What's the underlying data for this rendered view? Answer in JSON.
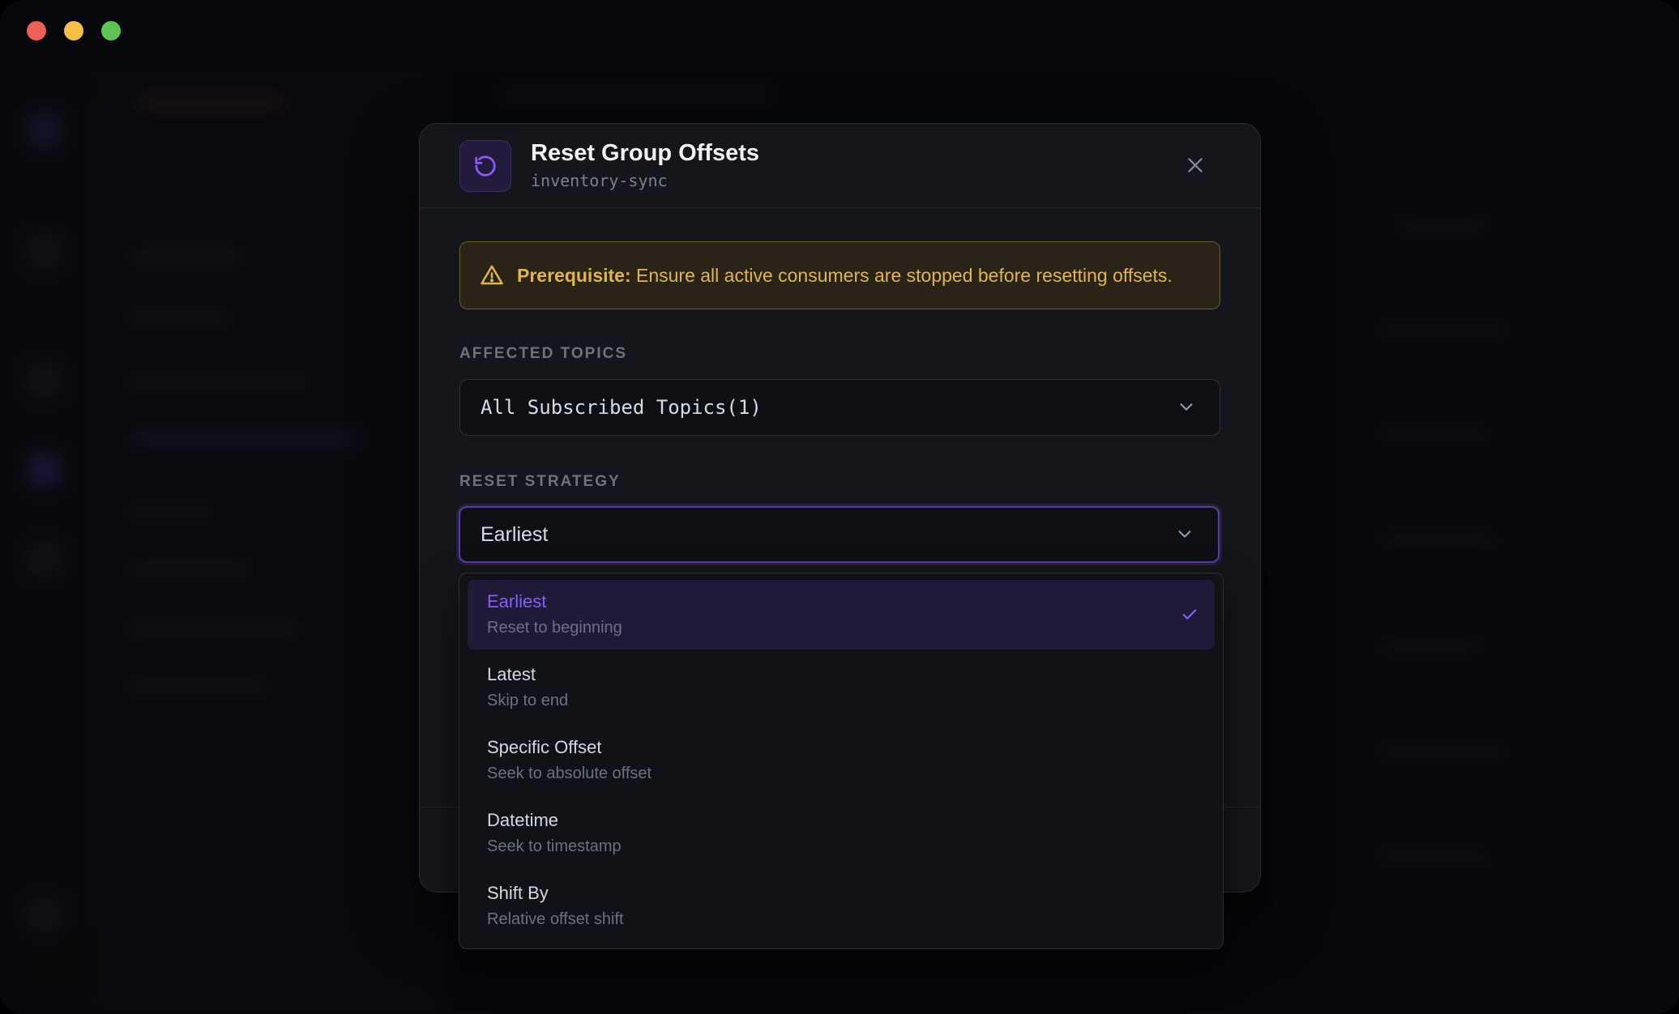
{
  "window": {
    "controls": [
      "close",
      "minimize",
      "maximize"
    ]
  },
  "modal": {
    "title": "Reset Group Offsets",
    "subtitle": "inventory-sync",
    "icon": "reset-icon",
    "close_icon": "close-icon"
  },
  "warning": {
    "icon": "alert-triangle-icon",
    "strong": "Prerequisite:",
    "text": " Ensure all active consumers are stopped before resetting offsets."
  },
  "topics": {
    "label": "AFFECTED TOPICS",
    "value": "All Subscribed Topics(1)"
  },
  "strategy": {
    "label": "RESET STRATEGY",
    "value": "Earliest",
    "options": [
      {
        "name": "Earliest",
        "desc": "Reset to beginning",
        "selected": true
      },
      {
        "name": "Latest",
        "desc": "Skip to end",
        "selected": false
      },
      {
        "name": "Specific Offset",
        "desc": "Seek to absolute offset",
        "selected": false
      },
      {
        "name": "Datetime",
        "desc": "Seek to timestamp",
        "selected": false
      },
      {
        "name": "Shift By",
        "desc": "Relative offset shift",
        "selected": false
      }
    ]
  },
  "colors": {
    "accent": "#8b5cf6",
    "warning": "#e0b64c",
    "modal_bg": "#15161b"
  }
}
